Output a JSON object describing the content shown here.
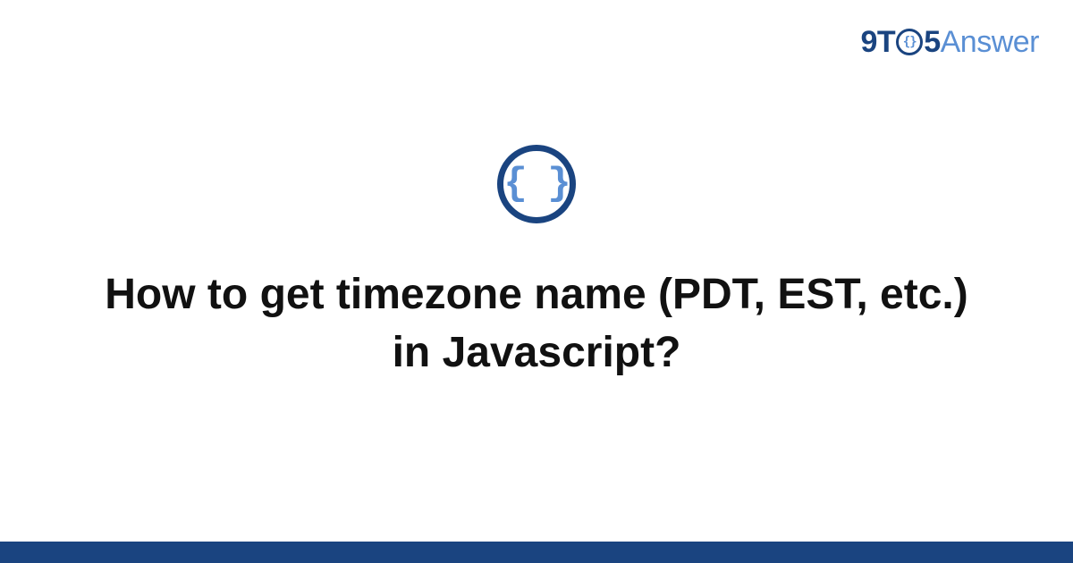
{
  "logo": {
    "part1": "9T",
    "circle_inner": "{}",
    "part2": "5",
    "part3": "Answer"
  },
  "icon": {
    "braces": "{ }"
  },
  "title": "How to get timezone name (PDT, EST, etc.) in Javascript?",
  "colors": {
    "primary_dark": "#1a4480",
    "primary_light": "#5a8fd4",
    "text": "#111111",
    "background": "#ffffff"
  }
}
